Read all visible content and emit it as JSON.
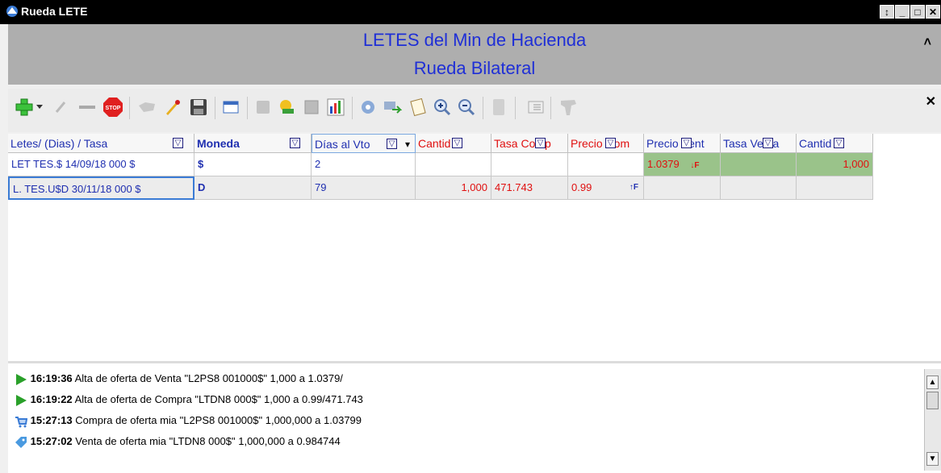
{
  "window": {
    "title": "Rueda LETE",
    "buttons": [
      "↕",
      "_",
      "□",
      "✕"
    ]
  },
  "header": {
    "line1": "LETES del Min de Hacienda",
    "line2": "Rueda Bilateral",
    "collapse_glyph": "˄"
  },
  "toolbar": {
    "icons": [
      "add-icon",
      "dropdown-arrow-icon",
      "edit-icon",
      "remove-icon",
      "stop-icon",
      "handshake-icon",
      "rocket-icon",
      "save-icon",
      "window-icon",
      "square-icon",
      "hand-icon",
      "image-icon",
      "chart-icon",
      "gear-icon",
      "transfer-icon",
      "clipboard-icon",
      "zoom-in-icon",
      "zoom-out-icon",
      "blank-icon",
      "layout-icon",
      "map-icon"
    ],
    "close_glyph": "✕"
  },
  "table": {
    "columns": [
      {
        "label": "Letes/ (Dias) / Tasa",
        "filter": "▽",
        "color": "#1f2fb0"
      },
      {
        "label": "Moneda",
        "filter": "▽",
        "color": "#1f2fb0",
        "bold": true
      },
      {
        "label": "Días al Vto",
        "filter": "▽",
        "sort": "▾",
        "color": "#1f2fb0"
      },
      {
        "label": "Cantid",
        "filter": "▽",
        "color": "#e01010"
      },
      {
        "label": "Tasa Comp",
        "filter": "▽",
        "color": "#e01010"
      },
      {
        "label": "Precio Com",
        "filter": "▽",
        "color": "#e01010"
      },
      {
        "label": "Precio Vent",
        "filter": "▽",
        "color": "#1f2fb0"
      },
      {
        "label": "Tasa Venta",
        "filter": "▽",
        "color": "#1f2fb0"
      },
      {
        "label": "Cantid",
        "filter": "▽",
        "color": "#1f2fb0"
      }
    ],
    "rows": [
      {
        "name": "LET TES.$ 14/09/18 000 $",
        "moneda": "$",
        "dias": "2",
        "cant_compra": "",
        "tasa_compra": "",
        "precio_compra": "",
        "precio_venta": "1.0379",
        "precio_venta_flag": "↓F",
        "tasa_venta": "",
        "cant_venta": "1,000"
      },
      {
        "name": "L. TES.U$D 30/11/18  000 $",
        "moneda": "D",
        "dias": "79",
        "cant_compra": "1,000",
        "tasa_compra": "471.743",
        "precio_compra": "0.99",
        "precio_compra_flag": "↑F",
        "precio_venta": "",
        "tasa_venta": "",
        "cant_venta": ""
      }
    ]
  },
  "log": [
    {
      "icon": "play-icon",
      "time": "16:19:36",
      "text": "Alta de oferta de Venta \"L2PS8 001000$\" 1,000 a 1.0379/"
    },
    {
      "icon": "play-icon",
      "time": "16:19:22",
      "text": "Alta de oferta de Compra \"LTDN8    000$\" 1,000 a 0.99/471.743"
    },
    {
      "icon": "cart-icon",
      "time": "15:27:13",
      "text": "Compra de oferta mia \"L2PS8 001000$\" 1,000,000 a 1.03799"
    },
    {
      "icon": "tag-icon",
      "time": "15:27:02",
      "text": "Venta de oferta mia \"LTDN8    000$\" 1,000,000 a 0.984744"
    }
  ],
  "colors": {
    "accent_blue": "#1f2fd6",
    "green_row": "#9ac38a",
    "red_text": "#e01010"
  }
}
